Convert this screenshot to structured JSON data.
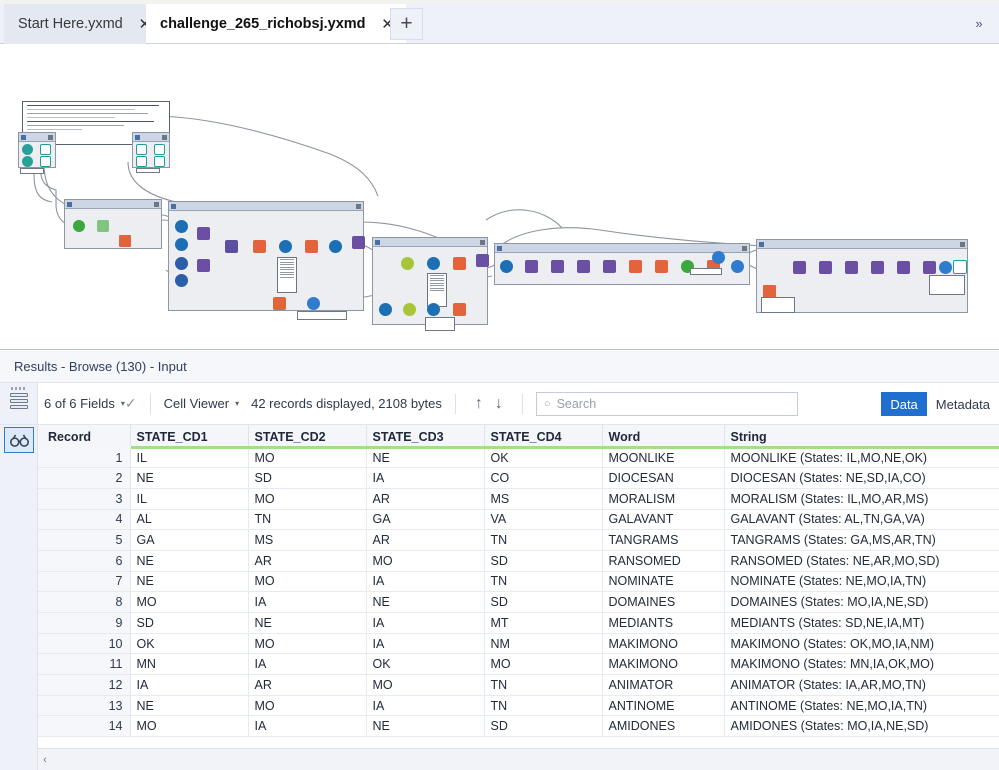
{
  "window": {
    "tabs": [
      {
        "label": "Start Here.yxmd",
        "active": false,
        "close": "✕"
      },
      {
        "label": "challenge_265_richobsj.yxmd",
        "active": true,
        "close": "✕"
      }
    ],
    "new_tab_label": "+",
    "expand_button": "»"
  },
  "results": {
    "title": "Results - Browse (130) - Input",
    "toolbar": {
      "fields_label": "6 of 6 Fields",
      "fields_caret": "▾",
      "check_icon": "✓",
      "view_mode": "Cell Viewer",
      "view_caret": "▾",
      "record_info": "42 records displayed, 2108 bytes",
      "up_arrow": "↑",
      "down_arrow": "↓",
      "search_placeholder": "Search",
      "search_value": "",
      "search_icon": "○",
      "data_tab": "Data",
      "metadata_tab": "Metadata"
    },
    "scroll_left_icon": "‹"
  },
  "table": {
    "columns": [
      "Record",
      "STATE_CD1",
      "STATE_CD2",
      "STATE_CD3",
      "STATE_CD4",
      "Word",
      "String"
    ],
    "rows": [
      [
        "1",
        "IL",
        "MO",
        "NE",
        "OK",
        "MOONLIKE",
        "MOONLIKE (States: IL,MO,NE,OK)"
      ],
      [
        "2",
        "NE",
        "SD",
        "IA",
        "CO",
        "DIOCESAN",
        "DIOCESAN (States: NE,SD,IA,CO)"
      ],
      [
        "3",
        "IL",
        "MO",
        "AR",
        "MS",
        "MORALISM",
        "MORALISM (States: IL,MO,AR,MS)"
      ],
      [
        "4",
        "AL",
        "TN",
        "GA",
        "VA",
        "GALAVANT",
        "GALAVANT (States: AL,TN,GA,VA)"
      ],
      [
        "5",
        "GA",
        "MS",
        "AR",
        "TN",
        "TANGRAMS",
        "TANGRAMS (States: GA,MS,AR,TN)"
      ],
      [
        "6",
        "NE",
        "AR",
        "MO",
        "SD",
        "RANSOMED",
        "RANSOMED (States: NE,AR,MO,SD)"
      ],
      [
        "7",
        "NE",
        "MO",
        "IA",
        "TN",
        "NOMINATE",
        "NOMINATE (States: NE,MO,IA,TN)"
      ],
      [
        "8",
        "MO",
        "IA",
        "NE",
        "SD",
        "DOMAINES",
        "DOMAINES (States: MO,IA,NE,SD)"
      ],
      [
        "9",
        "SD",
        "NE",
        "IA",
        "MT",
        "MEDIANTS",
        "MEDIANTS (States: SD,NE,IA,MT)"
      ],
      [
        "10",
        "OK",
        "MO",
        "IA",
        "NM",
        "MAKIMONO",
        "MAKIMONO (States: OK,MO,IA,NM)"
      ],
      [
        "11",
        "MN",
        "IA",
        "OK",
        "MO",
        "MAKIMONO",
        "MAKIMONO (States: MN,IA,OK,MO)"
      ],
      [
        "12",
        "IA",
        "AR",
        "MO",
        "TN",
        "ANIMATOR",
        "ANIMATOR (States: IA,AR,MO,TN)"
      ],
      [
        "13",
        "NE",
        "MO",
        "IA",
        "TN",
        "ANTINOME",
        "ANTINOME (States: NE,MO,IA,TN)"
      ],
      [
        "14",
        "MO",
        "IA",
        "NE",
        "SD",
        "AMIDONES",
        "AMIDONES (States: MO,IA,NE,SD)"
      ]
    ]
  },
  "colors": {
    "accent": "#1f6fd0",
    "header_underline": "#9fe08a",
    "tab_active_bg": "#ffffff",
    "tab_inactive_bg": "#e3e8f1",
    "canvas_bg": "#ffffff",
    "container_bg": "#eceef2"
  }
}
